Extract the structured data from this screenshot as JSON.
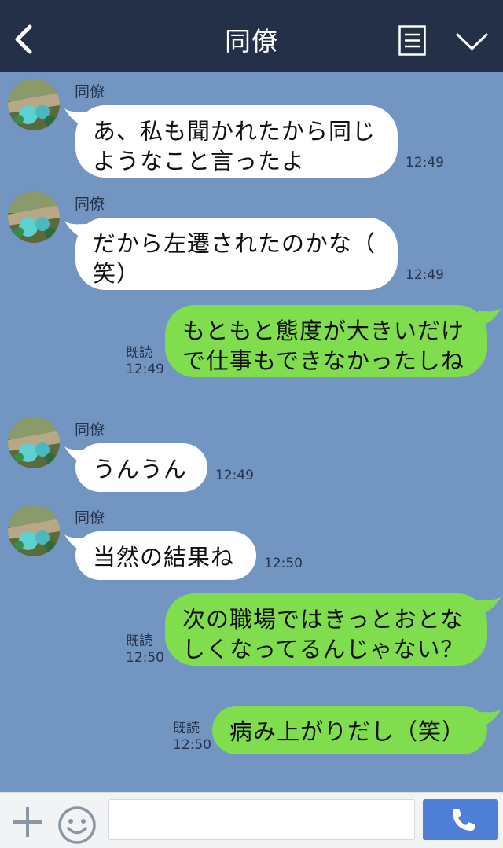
{
  "header": {
    "title": "同僚",
    "back_icon": "chevron-left-icon",
    "menu_icon": "menu-list-icon",
    "collapse_icon": "chevron-down-icon"
  },
  "messages": [
    {
      "side": "in",
      "sender": "同僚",
      "text": "あ、私も聞かれたから同じ\nようなこと言ったよ",
      "time": "12:49"
    },
    {
      "side": "in",
      "sender": "同僚",
      "text": "だから左遷されたのかな（\n笑）",
      "time": "12:49"
    },
    {
      "side": "out",
      "read": "既読",
      "text": "もともと態度が大きいだけ\nで仕事もできなかったしね",
      "time": "12:49"
    },
    {
      "side": "in",
      "sender": "同僚",
      "text": "うんうん",
      "time": "12:49"
    },
    {
      "side": "in",
      "sender": "同僚",
      "text": "当然の結果ね",
      "time": "12:50"
    },
    {
      "side": "out",
      "read": "既読",
      "text": "次の職場ではきっとおとな\nしくなってるんじゃない？",
      "time": "12:50"
    },
    {
      "side": "out",
      "read": "既読",
      "text": "病み上がりだし（笑）",
      "time": "12:50"
    }
  ],
  "footer": {
    "input_value": "",
    "plus_icon": "plus-icon",
    "emoji_icon": "smiley-icon",
    "call_icon": "phone-icon"
  },
  "colors": {
    "header": "#243047",
    "background": "#7395c2",
    "incoming": "#ffffff",
    "outgoing": "#80de4e",
    "call_button": "#4f7fd6"
  }
}
